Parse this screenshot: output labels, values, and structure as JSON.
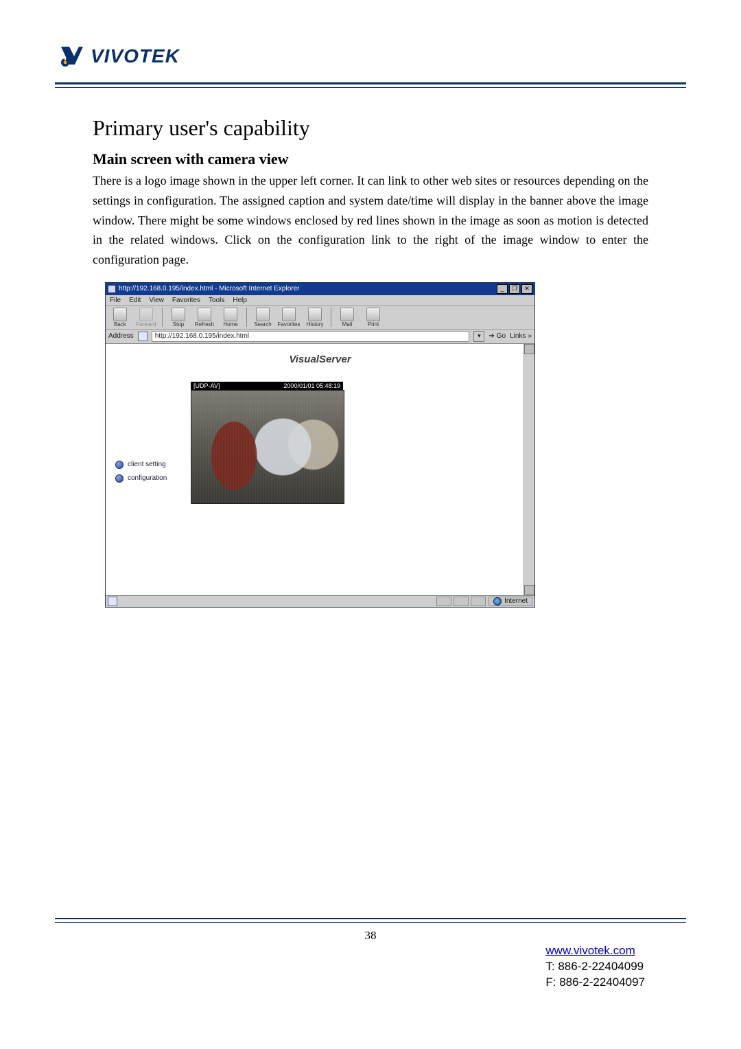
{
  "brand": {
    "name": "VIVOTEK"
  },
  "section": {
    "title": "Primary user's capability",
    "subtitle": "Main screen with camera view",
    "paragraph": "There is a logo image shown in the upper left corner. It can link to other web sites or resources depending on the settings in configuration. The assigned caption and system date/time will display in the banner above the image window. There might be some windows enclosed by red lines shown in the image as soon as motion is detected in the related windows. Click on the configuration link to the right of the image window to enter the configuration page."
  },
  "browser": {
    "title": "http://192.168.0.195/index.html - Microsoft Internet Explorer",
    "menu": {
      "file": "File",
      "edit": "Edit",
      "view": "View",
      "favorites": "Favorites",
      "tools": "Tools",
      "help": "Help"
    },
    "toolbar": {
      "back": "Back",
      "forward": "Forward",
      "stop": "Stop",
      "refresh": "Refresh",
      "home": "Home",
      "search": "Search",
      "favorites": "Favorites",
      "history": "History",
      "mail": "Mail",
      "print": "Print"
    },
    "address_label": "Address",
    "address_value": "http://192.168.0.195/index.html",
    "go_label": "Go",
    "links_label": "Links",
    "window_buttons": {
      "min": "_",
      "max": "❐",
      "close": "✕"
    },
    "status_zone": "Internet"
  },
  "app": {
    "banner": "VisualServer",
    "side": {
      "client_setting": "client setting",
      "configuration": "configuration"
    },
    "camera": {
      "proto": "[UDP-AV]",
      "timestamp": "2000/01/01 05:48:19"
    }
  },
  "footer": {
    "page_number": "38",
    "url": "www.vivotek.com",
    "tel": "T: 886-2-22404099",
    "fax": "F: 886-2-22404097"
  }
}
